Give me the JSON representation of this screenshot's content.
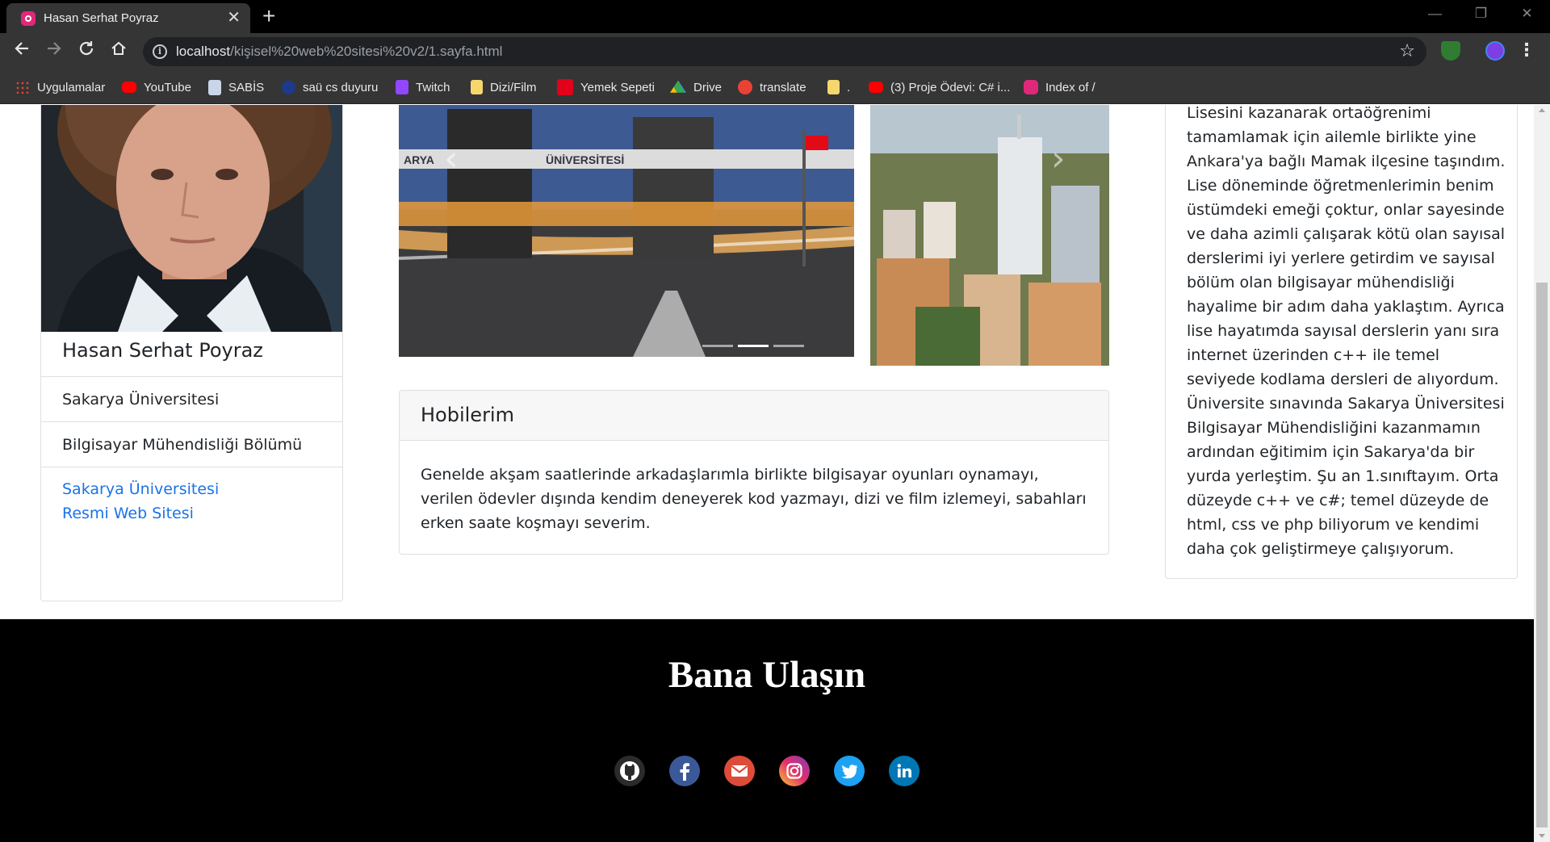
{
  "browser": {
    "tab_title": "Hasan Serhat Poyraz",
    "tab_close": "✕",
    "new_tab": "+",
    "url_host": "localhost",
    "url_path": "/kişisel%20web%20sitesi%20v2/1.sayfa.html",
    "window_controls": [
      "—",
      "❐",
      "✕"
    ]
  },
  "bookmarks": [
    {
      "label": "Uygulamalar",
      "icon": "apps-grid-icon",
      "color": "#e94235"
    },
    {
      "label": "YouTube",
      "icon": "youtube-icon",
      "color": "#ff0000"
    },
    {
      "label": "SABİS",
      "icon": "document-icon",
      "color": "#c9d6ea"
    },
    {
      "label": "saü cs duyuru",
      "icon": "globe-icon",
      "color": "#1e3a8a"
    },
    {
      "label": "Twitch",
      "icon": "twitch-icon",
      "color": "#9146ff"
    },
    {
      "label": "Dizi/Film",
      "icon": "folder-icon",
      "color": "#f5d76e"
    },
    {
      "label": "Yemek Sepeti",
      "icon": "yemeksepeti-icon",
      "color": "#e3001b"
    },
    {
      "label": "Drive",
      "icon": "drive-icon",
      "color": "#34a853"
    },
    {
      "label": "translate",
      "icon": "translate-icon",
      "color": "#e94235"
    },
    {
      "label": ".",
      "icon": "folder-icon",
      "color": "#f5d76e"
    },
    {
      "label": "(3) Proje Ödevi: C# i...",
      "icon": "youtube-icon",
      "color": "#ff0000"
    },
    {
      "label": "Index of /",
      "icon": "site-icon",
      "color": "#e0287a"
    }
  ],
  "profile": {
    "name": "Hasan Serhat Poyraz",
    "university": "Sakarya Üniversitesi",
    "department": "Bilgisayar Mühendisliği Bölümü",
    "link_line1": "Sakarya Üniversitesi",
    "link_line2": "Resmi Web Sitesi"
  },
  "carousel": {
    "prev": "‹",
    "next": "›",
    "slide_count": 3,
    "active_index": 1
  },
  "hobbies": {
    "title": "Hobilerim",
    "text": "Genelde akşam saatlerinde arkadaşlarımla birlikte bilgisayar oyunları oynamayı, verilen ödevler dışında kendim deneyerek kod yazmayı, dizi ve film izlemeyi, sabahları erken saate koşmayı severim."
  },
  "bio": {
    "text": "Lisesini kazanarak ortaöğrenimi tamamlamak için ailemle birlikte yine Ankara'ya bağlı Mamak ilçesine taşındım. Lise döneminde öğretmenlerimin benim üstümdeki emeği çoktur, onlar sayesinde ve daha azimli çalışarak kötü olan sayısal derslerimi iyi yerlere getirdim ve sayısal bölüm olan bilgisayar mühendisliği hayalime bir adım daha yaklaştım. Ayrıca lise hayatımda sayısal derslerin yanı sıra internet üzerinden c++ ile temel seviyede kodlama dersleri de alıyordum. Üniversite sınavında Sakarya Üniversitesi Bilgisayar Mühendisliğini kazanmamın ardından eğitimim için Sakarya'da bir yurda yerleştim. Şu an 1.sınıftayım. Orta düzeyde c++ ve c#; temel düzeyde de html, css ve php biliyorum ve kendimi daha çok geliştirmeye çalışıyorum."
  },
  "footer": {
    "title": "Bana Ulaşın",
    "social": [
      {
        "name": "github-icon",
        "color": "#333333"
      },
      {
        "name": "facebook-icon",
        "color": "#3b5998"
      },
      {
        "name": "email-icon",
        "color": "#dd4b39"
      },
      {
        "name": "instagram-icon",
        "color": "#c13584"
      },
      {
        "name": "twitter-icon",
        "color": "#1da1f2"
      },
      {
        "name": "linkedin-icon",
        "color": "#0077b5"
      }
    ]
  }
}
